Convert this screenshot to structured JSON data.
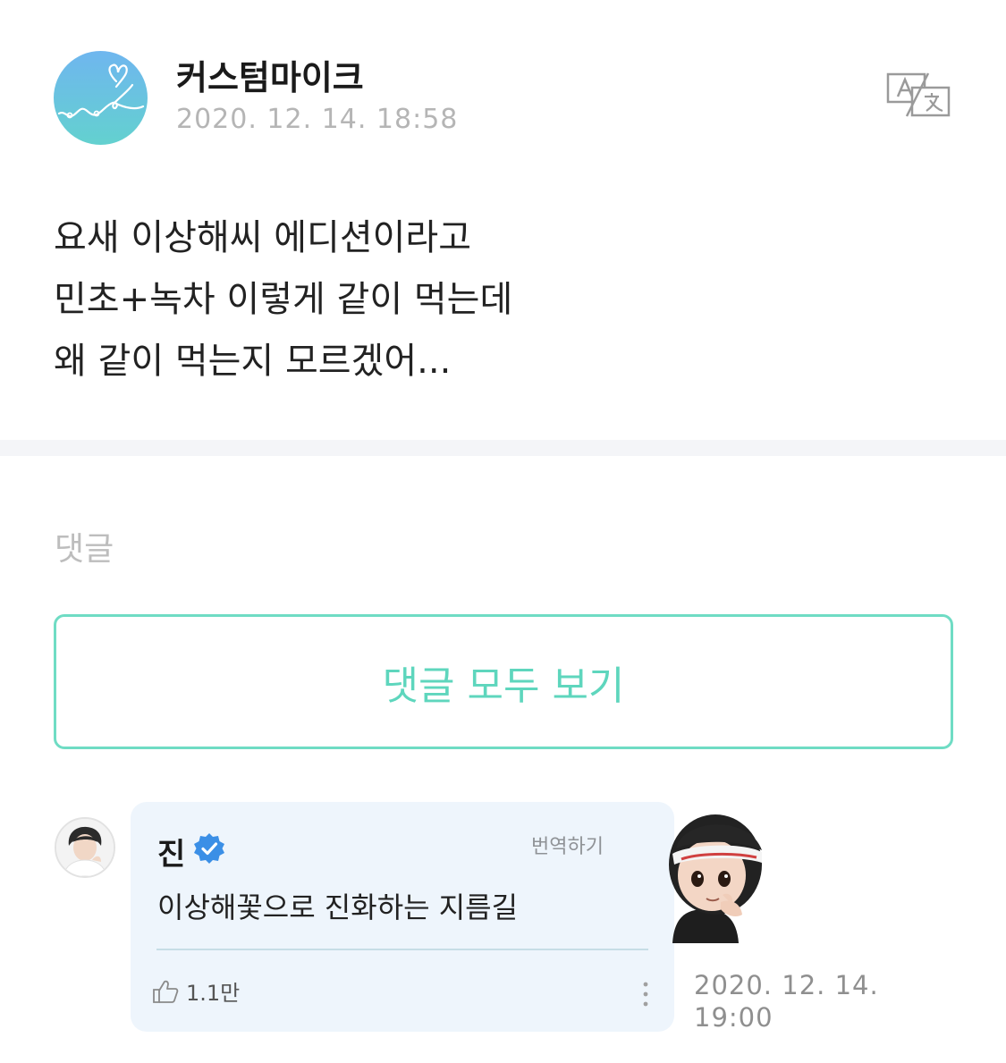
{
  "post": {
    "author": "커스텀마이크",
    "date": "2020. 12. 14. 18:58",
    "translate_icon": "translate-icon",
    "body_lines": [
      "요새 이상해씨 에디션이라고",
      "민초+녹차 이렇게 같이 먹는데",
      "왜 같이 먹는지 모르겠어..."
    ]
  },
  "comments": {
    "heading": "댓글",
    "view_all_label": "댓글 모두 보기",
    "items": [
      {
        "name": "진",
        "verified_icon": "verified-badge-icon",
        "translate_label": "번역하기",
        "text": "이상해꽃으로 진화하는 지름길",
        "like_count": "1.1만",
        "date_line1": "2020. 12. 14.",
        "date_line2": "19:00"
      }
    ]
  },
  "colors": {
    "accent": "#5ed6bd",
    "bubble": "#eef5fc",
    "verified": "#3b8fe6",
    "muted": "#b5b5b5"
  }
}
